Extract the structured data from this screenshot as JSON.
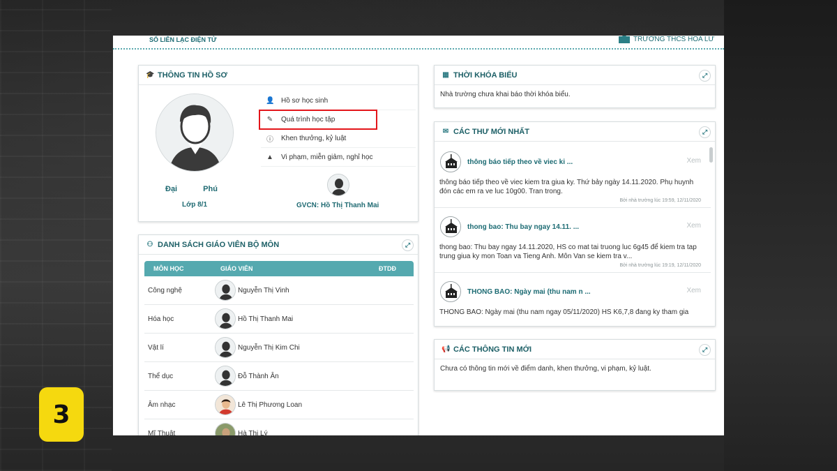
{
  "step_number": "3",
  "topbar": {
    "brand": "SỔ LIÊN LẠC ĐIỆN TỬ",
    "school": "TRƯỜNG THCS HOA LƯ"
  },
  "profile": {
    "title": "THÔNG TIN HỒ SƠ",
    "student_name": "Đại Phú",
    "student_class": "Lớp 8/1",
    "menu": [
      {
        "label": "Hồ sơ học sinh",
        "icon": "user-icon"
      },
      {
        "label": "Quá trình học tập",
        "icon": "edit-icon"
      },
      {
        "label": "Khen thưởng, kỷ luật",
        "icon": "info-icon"
      },
      {
        "label": "Vi phạm, miễn giảm, nghỉ học",
        "icon": "warning-icon"
      }
    ],
    "homeroom": "GVCN: Hồ Thị Thanh Mai"
  },
  "teachers": {
    "title": "DANH SÁCH GIÁO VIÊN BỘ MÔN",
    "columns": [
      "MÔN HỌC",
      "GIÁO VIÊN",
      "ĐTDĐ"
    ],
    "rows": [
      {
        "subject": "Công nghệ",
        "teacher": "Nguyễn Thị Vinh"
      },
      {
        "subject": "Hóa học",
        "teacher": "Hồ Thị Thanh Mai"
      },
      {
        "subject": "Vật lí",
        "teacher": "Nguyễn Thị Kim Chi"
      },
      {
        "subject": "Thể dục",
        "teacher": "Đỗ Thành Ân"
      },
      {
        "subject": "Âm nhạc",
        "teacher": "Lê Thị Phương Loan"
      },
      {
        "subject": "Mĩ Thuật",
        "teacher": "Hà Thị Lý"
      }
    ]
  },
  "timetable": {
    "title": "THỜI KHÓA BIỂU",
    "text": "Nhà trường chưa khai báo thời khóa biểu."
  },
  "mail": {
    "title": "CÁC THƯ MỚI NHẤT",
    "view_label": "Xem",
    "items": [
      {
        "title": "thông báo tiếp theo về viec ki ...",
        "text": "thông báo tiếp theo về viec kiem tra giua ky. Thứ bảy ngày 14.11.2020. Phụ huynh đón các em ra ve luc 10g00. Tran trong.",
        "date": "Bởi nhà trường lúc 19:59, 12/11/2020"
      },
      {
        "title": "thong bao: Thu bay ngay 14.11. ...",
        "text": "thong bao: Thu bay ngay 14.11.2020, HS co mat tai truong luc 6g45 để kiem tra tap trung giua ky mon Toan va Tieng Anh. Môn Van se kiem tra v...",
        "date": "Bởi nhà trường lúc 19:19, 12/11/2020"
      },
      {
        "title": "THONG BAO: Ngày mai (thu nam n ...",
        "text": "THONG BAO: Ngày mai (thu nam ngay 05/11/2020) HS K6,7,8 đang ky tham gia",
        "date": ""
      }
    ]
  },
  "info": {
    "title": "CÁC THÔNG TIN MỚI",
    "text": "Chưa có thông tin mới về điểm danh, khen thưởng, vi phạm, kỷ luật."
  },
  "colors": {
    "accent": "#1c6b73",
    "table_header": "#55a9af",
    "highlight": "#e3151a",
    "badge": "#f5d90f"
  }
}
